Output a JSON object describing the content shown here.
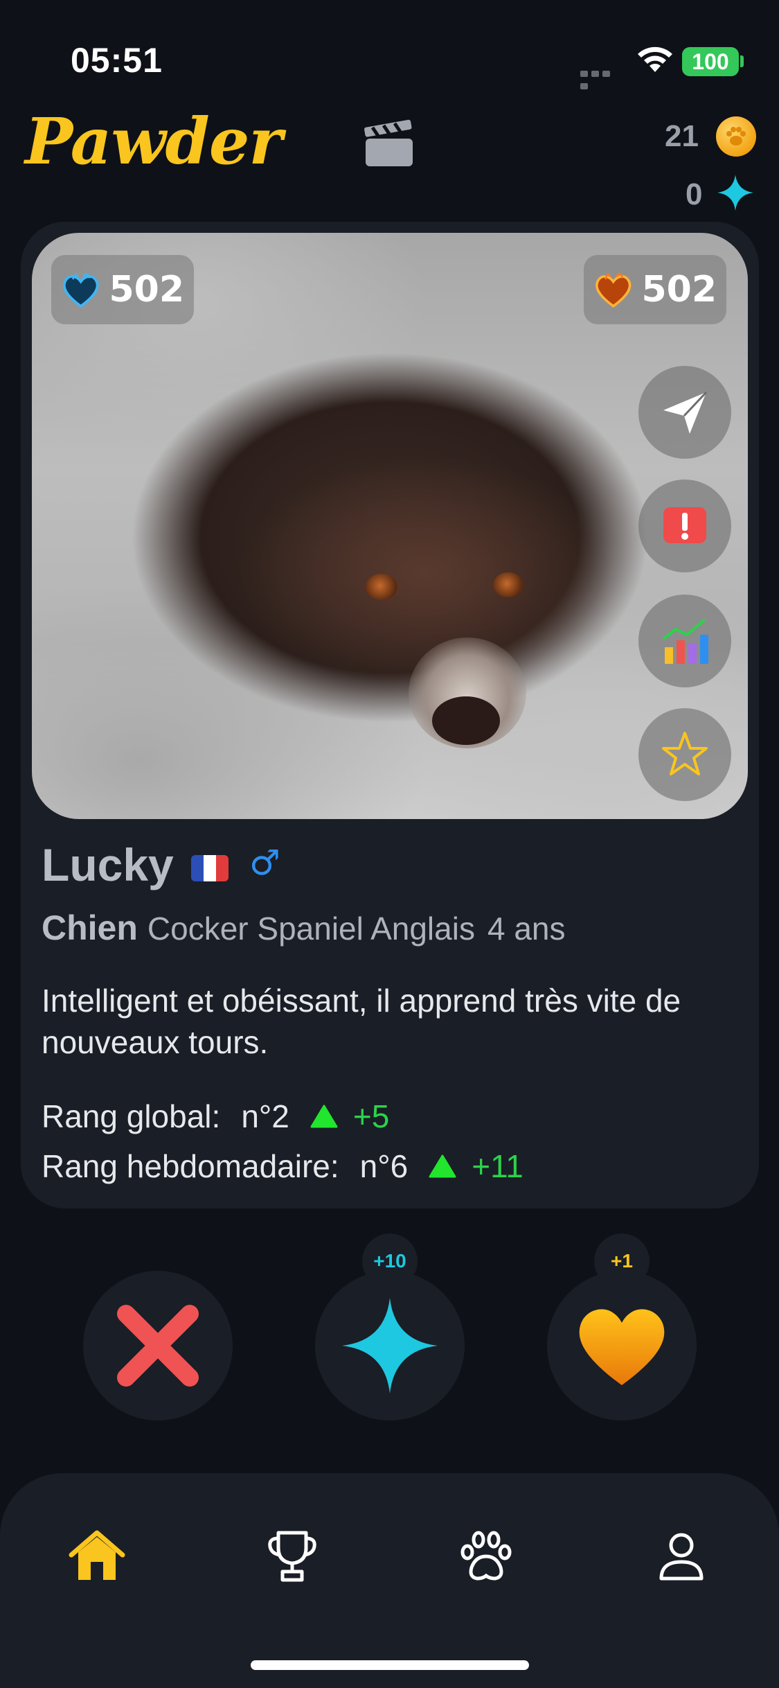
{
  "status_bar": {
    "time": "05:51",
    "battery": "100"
  },
  "header": {
    "app_name": "Pawder",
    "coins": "21",
    "sparks": "0"
  },
  "card": {
    "score_left": "502",
    "score_right": "502",
    "pet": {
      "name": "Lucky",
      "gender_symbol": "♂",
      "species": "Chien",
      "breed": "Cocker Spaniel Anglais",
      "age": "4 ans",
      "description": "Intelligent et obéissant, il apprend très vite de nouveaux tours."
    },
    "ranks": [
      {
        "label": "Rang global:",
        "value": "n°2",
        "delta": "+5"
      },
      {
        "label": "Rang hebdomadaire:",
        "value": "n°6",
        "delta": "+11"
      }
    ],
    "side_actions": [
      "send-icon",
      "report-icon",
      "stats-icon",
      "favorite-star-icon"
    ]
  },
  "actions": {
    "dislike_icon": "close-x-icon",
    "superlike_icon": "sparkle-icon",
    "superlike_badge": "+10",
    "like_icon": "heart-icon",
    "like_badge": "+1"
  },
  "nav": {
    "items": [
      "home-icon",
      "trophy-icon",
      "paw-icon",
      "profile-icon"
    ],
    "active": "home-icon",
    "active_color": "#f9c51e"
  },
  "colors": {
    "accent": "#f9c51e",
    "background": "#0e1117",
    "card": "#1a1e26",
    "rank_up": "#2bd34a",
    "spark": "#1ec8e0",
    "dislike": "#f05353",
    "like": "#f5a20a"
  }
}
